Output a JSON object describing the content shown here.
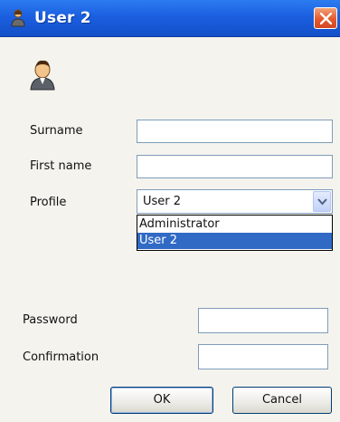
{
  "window": {
    "title": "User 2",
    "icon": "user-icon",
    "close_icon": "close-icon"
  },
  "form": {
    "avatar_icon": "user-avatar-icon",
    "surname": {
      "label": "Surname",
      "value": ""
    },
    "first_name": {
      "label": "First name",
      "value": ""
    },
    "profile": {
      "label": "Profile",
      "selected": "User 2",
      "options": [
        "Administrator",
        "User 2"
      ]
    },
    "password": {
      "label": "Password",
      "value": ""
    },
    "confirmation": {
      "label": "Confirmation",
      "value": ""
    }
  },
  "buttons": {
    "ok": "OK",
    "cancel": "Cancel"
  },
  "colors": {
    "titlebar": "#1b5fe0",
    "selection": "#316ac5",
    "close": "#e5592d"
  }
}
